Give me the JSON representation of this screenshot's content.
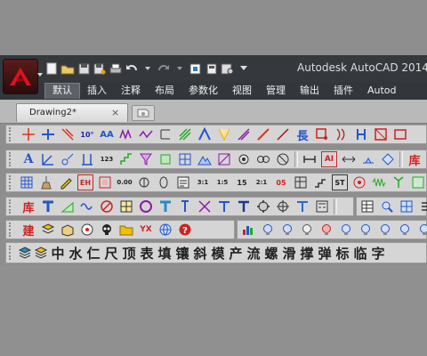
{
  "window": {
    "title": "Autodesk AutoCAD 2014"
  },
  "ribbon_tabs": [
    "默认",
    "插入",
    "注释",
    "布局",
    "参数化",
    "视图",
    "管理",
    "输出",
    "插件",
    "Autod"
  ],
  "document_tab": {
    "name": "Drawing2*",
    "close": "×"
  },
  "toolbars": {
    "row1": [
      "T",
      "A",
      "│",
      "↗",
      "A",
      "✡",
      "╲",
      "■",
      "▓",
      "△",
      "░",
      "∕",
      "╲",
      "∕",
      "長",
      "□",
      "◗",
      "⎕",
      "☒",
      "□"
    ],
    "row2": [
      "A",
      "↗",
      "◎",
      "⬓",
      "123",
      "■",
      "⌇",
      "⌆",
      "⊞",
      "△",
      "⊠",
      "⊗",
      "⊗",
      "⊟",
      "AI",
      "↔",
      "▲",
      "◆",
      "库"
    ],
    "row3": [
      "▒",
      "∴",
      "◆",
      "EH",
      "▣",
      "0.00",
      "⊖",
      "◌",
      "▤",
      "3:1",
      "1:5",
      "15",
      "2:1",
      "05",
      "▦",
      "≡",
      "ST",
      "◎",
      "⊘",
      "∴",
      "▥"
    ],
    "row4": [
      "库",
      "T",
      "▲",
      "≈",
      "◎",
      "▣",
      "⊙",
      "T",
      "△",
      "≡",
      "T",
      "T",
      "⚙",
      "⊗",
      "T",
      "▣",
      "▦",
      "⊙",
      "▤"
    ],
    "row5": [
      "建",
      "▤",
      "◇",
      "◎",
      "☠",
      "□",
      "YX",
      "⊙",
      "⊕",
      "⬛",
      "⊙",
      "◈",
      "◉",
      "◎",
      "☢",
      "●",
      "◐",
      "◑",
      "◎",
      "◉"
    ],
    "row6_chars": [
      "中",
      "水",
      "仁",
      "尺",
      "顶",
      "表",
      "填",
      "镶",
      "斜",
      "模",
      "产",
      "流",
      "螺",
      "滑",
      "撑",
      "弹",
      "标",
      "临",
      "字"
    ]
  },
  "colors": {
    "titlebar": "#35393e",
    "toolbar": "#d5d5d5",
    "autocad_red": "#c8101f"
  }
}
